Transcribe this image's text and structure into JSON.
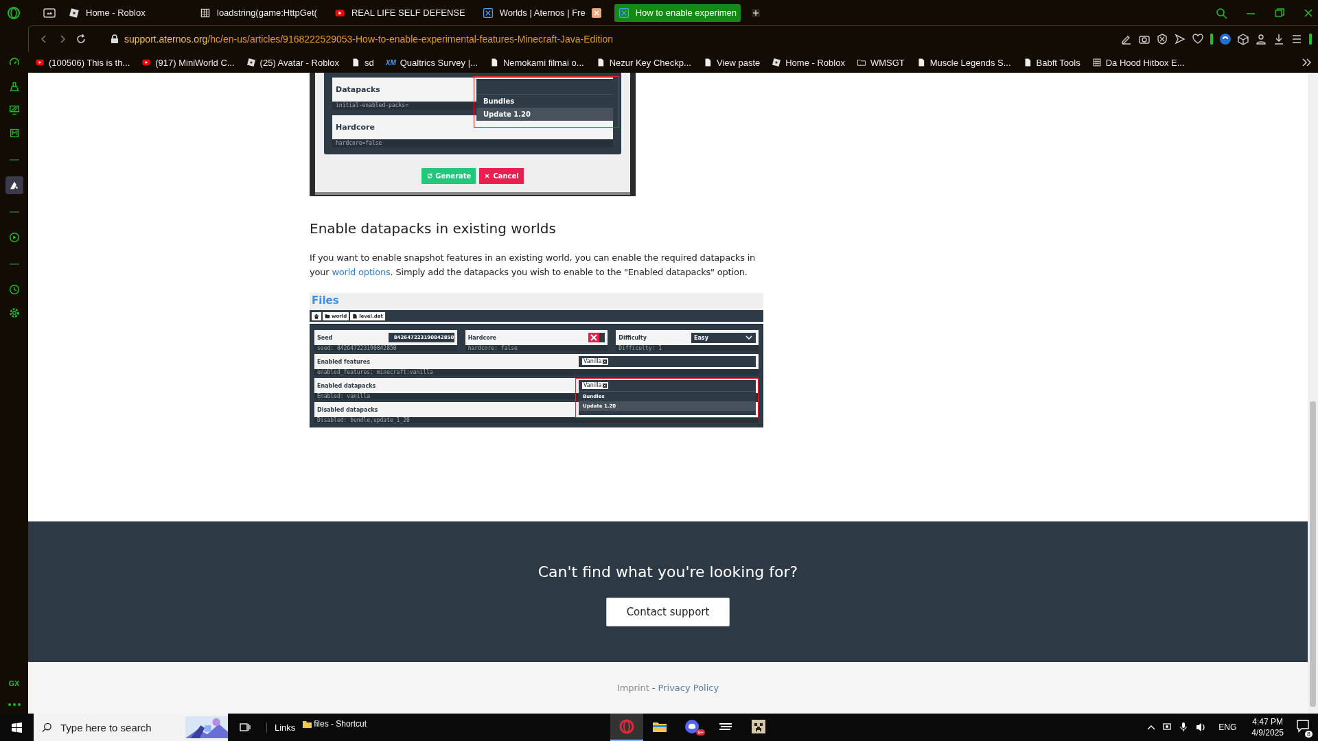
{
  "browser": {
    "tabs": [
      {
        "title": "Home - Roblox",
        "kind": "roblox",
        "selected": false,
        "hovered": false
      },
      {
        "title": "loadstring(game:HttpGet(",
        "kind": "grid",
        "selected": false,
        "hovered": false
      },
      {
        "title": "REAL LIFE SELF DEFENSE",
        "kind": "youtube",
        "selected": false,
        "hovered": false
      },
      {
        "title": "Worlds | Aternos | Fre",
        "kind": "aternos",
        "selected": false,
        "hovered": true
      },
      {
        "title": "How to enable experimen",
        "kind": "aternos",
        "selected": true,
        "hovered": false
      }
    ],
    "url_host": "support.aternos.org",
    "url_path": "/hc/en-us/articles/9168222529053-How-to-enable-experimental-features-Minecraft-Java-Edition",
    "bookmarks": [
      {
        "label": "(100506) This is th...",
        "kind": "youtube"
      },
      {
        "label": "(917) MiniWorld C...",
        "kind": "youtube"
      },
      {
        "label": "(25) Avatar - Roblox",
        "kind": "roblox"
      },
      {
        "label": "sd",
        "kind": "page"
      },
      {
        "label": "Qualtrics Survey |...",
        "kind": "qualtrics",
        "icon_text": "XM"
      },
      {
        "label": "Nemokami filmai o...",
        "kind": "page"
      },
      {
        "label": "Nezur Key Checkp...",
        "kind": "page"
      },
      {
        "label": "View paste",
        "kind": "page"
      },
      {
        "label": "Home - Roblox",
        "kind": "roblox"
      },
      {
        "label": "WMSGT",
        "kind": "folder"
      },
      {
        "label": "Muscle Legends S...",
        "kind": "page"
      },
      {
        "label": "Babft Tools",
        "kind": "page"
      },
      {
        "label": "Da Hood Hitbox E...",
        "kind": "grid"
      }
    ]
  },
  "sidebar": {
    "items": [
      {
        "kind": "speed",
        "selected": false
      },
      {
        "kind": "cleaner",
        "selected": false
      },
      {
        "kind": "monitor",
        "selected": false
      },
      {
        "kind": "chip",
        "selected": false
      },
      {
        "kind": "divider",
        "selected": false
      },
      {
        "kind": "aternos",
        "selected": true
      },
      {
        "kind": "divider",
        "selected": false
      },
      {
        "kind": "player",
        "selected": false
      },
      {
        "kind": "divider",
        "selected": false
      },
      {
        "kind": "history",
        "selected": false
      },
      {
        "kind": "settings",
        "selected": false
      }
    ],
    "badge": "GX"
  },
  "article": {
    "figure_1": {
      "rows": [
        {
          "label": "Datapacks",
          "hint": "initial-enabled-packs="
        },
        {
          "label": "Hardcore",
          "hint": "hardcore=false"
        }
      ],
      "dropdown": [
        {
          "label": "Bundles",
          "selected": false
        },
        {
          "label": "Update 1.20",
          "selected": true
        }
      ],
      "buttons": [
        {
          "label": "Generate",
          "kind": "confirm"
        },
        {
          "label": "Cancel",
          "kind": "cancel"
        }
      ]
    },
    "heading": "Enable datapacks in existing worlds",
    "paragraph": {
      "before": "If you want to enable snapshot features in an existing world, you can enable the required datapacks in your",
      "link": "world options",
      "after": ". Simply add the datapacks you wish to enable to the \"Enabled datapacks\" option."
    },
    "figure_2": {
      "title": "Files",
      "breadcrumbs": [
        {
          "kind": "home"
        },
        {
          "kind": "folder",
          "label": "world"
        },
        {
          "kind": "file",
          "label": "level.dat"
        }
      ],
      "fields": [
        {
          "kind": "text",
          "label": "Seed",
          "value": "842647223190842850",
          "hint": "seed: 842647223190842850"
        },
        {
          "kind": "toggle",
          "label": "Hardcore",
          "on": false,
          "hint": "hardcore: false"
        },
        {
          "kind": "select",
          "label": "Difficulty",
          "value": "Easy",
          "hint": "Difficulty: 1"
        },
        {
          "kind": "tags",
          "label": "Enabled features",
          "tags": [
            "Vanilla"
          ],
          "hint": "enabled_features: minecraft:vanilla"
        },
        {
          "kind": "tags",
          "label": "Enabled datapacks",
          "tags": [
            "Vanilla"
          ],
          "hint": "Enabled: vanilla",
          "dropdown": [
            {
              "label": "Bundles",
              "selected": false
            },
            {
              "label": "Update 1.20",
              "selected": true
            }
          ]
        },
        {
          "kind": "tags",
          "label": "Disabled datapacks",
          "hint": "Disabled: bundle,update_1_20"
        }
      ]
    }
  },
  "footer": {
    "prompt": "Can't find what you're looking for?",
    "button": "Contact support",
    "links": [
      "Imprint",
      "Privacy Policy"
    ],
    "separator": "-"
  },
  "taskbar": {
    "search_placeholder": "Type here to search",
    "links_label": "Links",
    "shortcut": "files - Shortcut",
    "apps": [
      {
        "kind": "opera",
        "selected": true
      },
      {
        "kind": "explorer",
        "selected": false
      },
      {
        "kind": "discord",
        "selected": false,
        "badge": "9+"
      },
      {
        "kind": "app",
        "selected": false
      },
      {
        "kind": "minecraft",
        "selected": false
      }
    ],
    "language": "ENG",
    "time": "4:47 PM",
    "date": "4/9/2025",
    "notifications": "8"
  }
}
